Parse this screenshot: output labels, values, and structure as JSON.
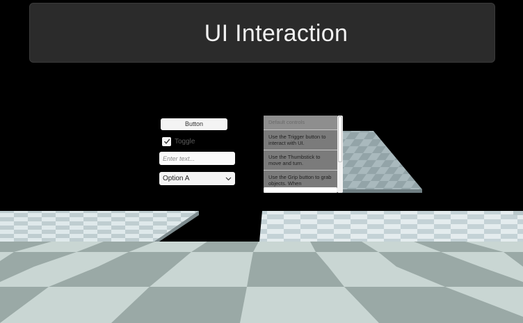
{
  "title": "UI Interaction",
  "controls": {
    "button_label": "Button",
    "toggle_label": "Toggle",
    "toggle_checked": true,
    "input_placeholder": "Enter text...",
    "dropdown_value": "Option A"
  },
  "scroll_list": {
    "header": "Default controls",
    "items": [
      "Use the Trigger button to interact with UI.",
      "Use the Thumbstick to move and turn.",
      "Use the Grip button to grab objects. When"
    ]
  },
  "colors": {
    "background": "#000000",
    "title_panel": "#2b2b2b",
    "floor_light": "#c9d6d3",
    "floor_dark": "#9aa9a6"
  },
  "icons": {
    "checkmark": "checkmark-icon",
    "dropdown_arrow": "chevron-down-icon"
  }
}
